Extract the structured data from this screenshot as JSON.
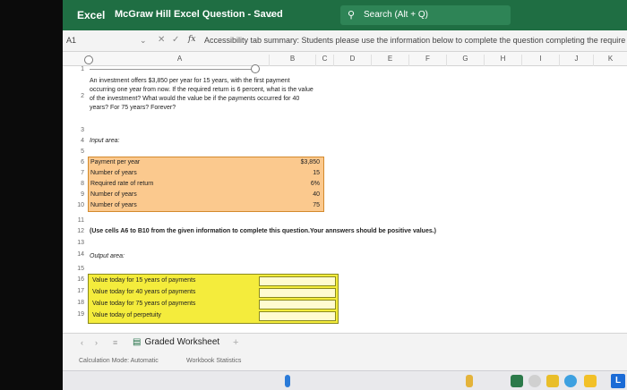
{
  "app": {
    "name": "Excel",
    "doc_title": "McGraw Hill Excel Question - Saved"
  },
  "search": {
    "label": "Search (Alt + Q)"
  },
  "formula_bar": {
    "cell_ref": "A1",
    "formula": "Accessibility tab summary: Students please use the information below to complete the question completing the require"
  },
  "columns": [
    "A",
    "B",
    "C",
    "D",
    "E",
    "F",
    "G",
    "H",
    "I",
    "J",
    "K"
  ],
  "question": {
    "lines": [
      "An investment offers $3,850 per year for 15 years, with the first payment",
      "occurring one year from now. If the required return is 6 percent, what is the value",
      "of the investment? What would the value be if the payments occurred for 40",
      "years? For 75 years? Forever?"
    ]
  },
  "input_area": {
    "heading": "Input area:",
    "rows": [
      {
        "row": "6",
        "label": "Payment per year",
        "value": "$3,850"
      },
      {
        "row": "7",
        "label": "Number of years",
        "value": "15"
      },
      {
        "row": "8",
        "label": "Required rate of return",
        "value": "6%"
      },
      {
        "row": "9",
        "label": "Number of years",
        "value": "40"
      },
      {
        "row": "10",
        "label": "Number of years",
        "value": "75"
      }
    ]
  },
  "instruction": "(Use cells A6 to B10 from the given information to complete this question.Your annswers should be positive values.)",
  "output_area": {
    "heading": "Output area:",
    "rows": [
      {
        "row": "16",
        "label": "Value today for 15 years of payments"
      },
      {
        "row": "17",
        "label": "Value today for 40 years of payments"
      },
      {
        "row": "18",
        "label": "Value today for 75 years of payments"
      },
      {
        "row": "19",
        "label": "Value today of perpetuity"
      }
    ]
  },
  "row_labels": {
    "r1": "1",
    "r2": "2",
    "r3": "3",
    "r4": "4",
    "r5": "5",
    "r11": "11",
    "r12": "12",
    "r13": "13",
    "r14": "14",
    "r15": "15"
  },
  "sheet": {
    "tab_label": "Graded Worksheet"
  },
  "status": {
    "calc_mode": "Calculation Mode: Automatic",
    "workbook_stats": "Workbook Statistics"
  },
  "colors": {
    "ribbon": "#1f6e43",
    "input_fill": "#fbc98e",
    "output_fill": "#f4ec3c"
  }
}
